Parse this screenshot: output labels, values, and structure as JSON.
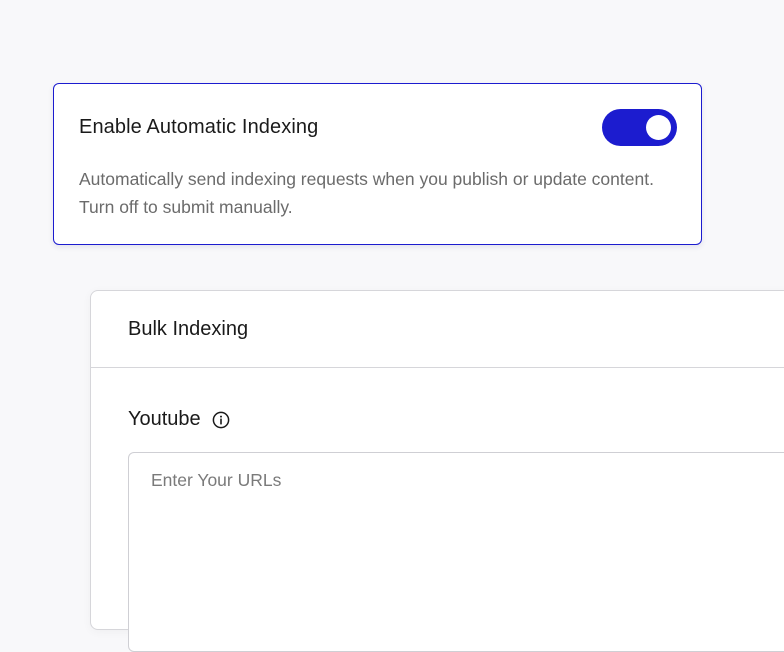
{
  "auto_indexing": {
    "title": "Enable Automatic Indexing",
    "enabled": true,
    "description": "Automatically send indexing requests when you publish or update content. Turn off to submit manually."
  },
  "bulk_indexing": {
    "title": "Bulk Indexing",
    "field_label": "Youtube",
    "input_value": "",
    "input_placeholder": "Enter Your URLs"
  },
  "colors": {
    "accent": "#1c1ccf",
    "muted_text": "#6b6b6b",
    "border": "#d6d6da"
  }
}
